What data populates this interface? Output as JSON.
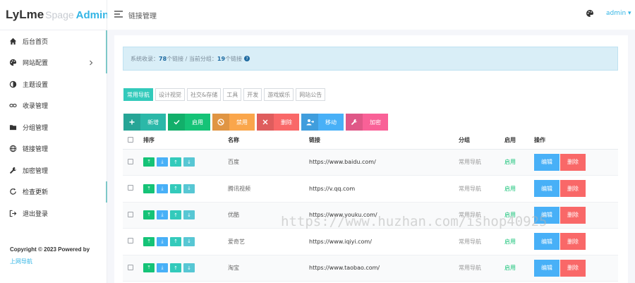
{
  "brand": {
    "part1": "LyLme",
    "part2": "Spage",
    "part3": "Admin"
  },
  "sidebar": {
    "items": [
      {
        "label": "后台首页",
        "icon": "home-icon"
      },
      {
        "label": "网站配置",
        "icon": "palette-icon"
      },
      {
        "label": "主题设置",
        "icon": "contrast-icon"
      },
      {
        "label": "收录管理",
        "icon": "link-icon"
      },
      {
        "label": "分组管理",
        "icon": "folder-icon"
      },
      {
        "label": "链接管理",
        "icon": "globe-icon"
      },
      {
        "label": "加密管理",
        "icon": "wrench-icon"
      },
      {
        "label": "检查更新",
        "icon": "refresh-icon"
      },
      {
        "label": "退出登录",
        "icon": "logout-icon"
      }
    ],
    "copyright": "Copyright © 2023 Powered by",
    "copyright_link": "上网导航"
  },
  "header": {
    "title": "链接管理",
    "user": "admin ▾"
  },
  "alert": {
    "prefix": "系统收录：",
    "total": "78",
    "mid": " 个链接 / 当前分组：",
    "current": "19",
    "suffix": " 个链接"
  },
  "tabs": [
    "常用导航",
    "设计视觉",
    "社交&存储",
    "工具",
    "开发",
    "游戏娱乐",
    "网站公告"
  ],
  "toolbar": [
    {
      "label": "新增",
      "icon": "plus-icon",
      "color": "#2bb8a8"
    },
    {
      "label": "启用",
      "icon": "check-icon",
      "color": "#15c377"
    },
    {
      "label": "禁用",
      "icon": "ban-icon",
      "color": "#faa64b"
    },
    {
      "label": "删除",
      "icon": "times-icon",
      "color": "#f96868"
    },
    {
      "label": "移动",
      "icon": "user-move-icon",
      "color": "#48b0f7"
    },
    {
      "label": "加密",
      "icon": "wrench-icon",
      "color": "#f96197"
    }
  ],
  "table": {
    "headers": [
      "排序",
      "名称",
      "链接",
      "分组",
      "启用",
      "操作"
    ],
    "rows": [
      {
        "name": "百度",
        "url": "https://www.baidu.com/",
        "group": "常用导航",
        "enabled": "启用"
      },
      {
        "name": "腾讯视频",
        "url": "https://v.qq.com",
        "group": "常用导航",
        "enabled": "启用"
      },
      {
        "name": "优酷",
        "url": "https://www.youku.com/",
        "group": "常用导航",
        "enabled": "启用"
      },
      {
        "name": "爱奇艺",
        "url": "https://www.iqiyi.com/",
        "group": "常用导航",
        "enabled": "启用"
      },
      {
        "name": "淘宝",
        "url": "https://www.taobao.com/",
        "group": "常用导航",
        "enabled": "启用"
      }
    ],
    "sort_buttons": [
      {
        "glyph": "⤒",
        "color": "#15c377",
        "name": "top-icon"
      },
      {
        "glyph": "⤓",
        "color": "#48b0f7",
        "name": "bottom-icon"
      },
      {
        "glyph": "↑",
        "color": "#33cabb",
        "name": "up-icon"
      },
      {
        "glyph": "↓",
        "color": "#57c7d4",
        "name": "down-icon"
      }
    ],
    "edit_label": "编辑",
    "delete_label": "删除"
  },
  "watermark": "https://www.huzhan.com/ishop40925"
}
